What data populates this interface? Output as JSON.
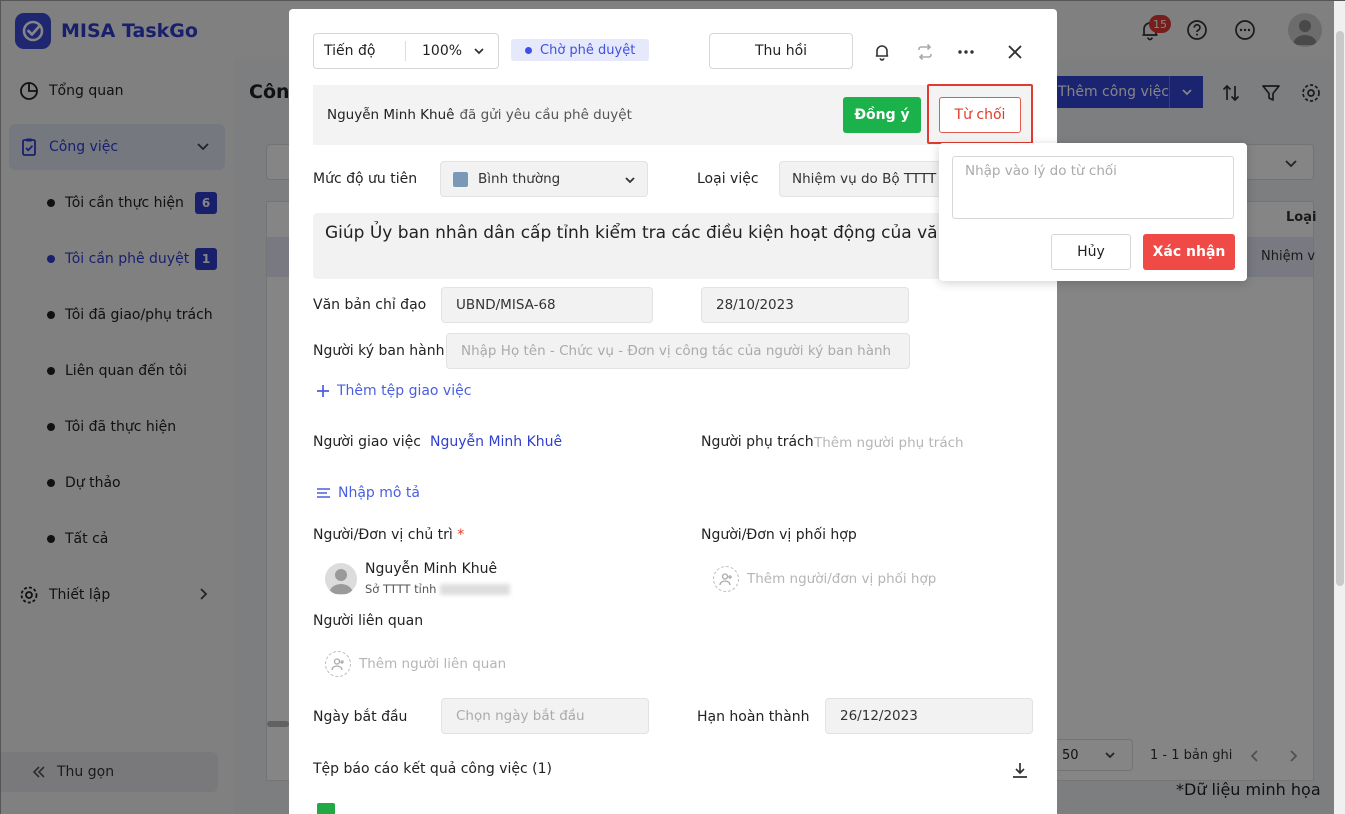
{
  "brand": {
    "name": "MISA TaskGo"
  },
  "sidebar": {
    "items": [
      {
        "label": "Tổng quan"
      },
      {
        "label": "Công việc"
      },
      {
        "label": "Thiết lập"
      }
    ],
    "sub_items": [
      {
        "label": "Tôi cần thực hiện",
        "badge": "6"
      },
      {
        "label": "Tôi cần phê duyệt",
        "badge": "1"
      },
      {
        "label": "Tôi đã giao/phụ trách"
      },
      {
        "label": "Liên quan đến tôi"
      },
      {
        "label": "Tôi đã thực hiện"
      },
      {
        "label": "Dự thảo"
      },
      {
        "label": "Tất cả"
      }
    ],
    "collapse_label": "Thu gọn"
  },
  "header": {
    "notification_count": "15"
  },
  "background": {
    "page_title": "Côn",
    "add_button": "Thêm công việc",
    "column_header": "Loại",
    "column_cell": "Nhiệm v",
    "page_size": "50",
    "pager_info": "1 - 1 bản ghi"
  },
  "modal": {
    "progress_label": "Tiến độ",
    "progress_value": "100%",
    "status": "Chờ phê duyệt",
    "recall_button": "Thu hồi",
    "approval": {
      "requester": "Nguyễn Minh Khuê",
      "message": "đã gửi yêu cầu phê duyệt",
      "agree_button": "Đồng ý",
      "reject_button": "Từ chối"
    },
    "priority_label": "Mức độ ưu tiên",
    "priority_value": "Bình thường",
    "task_type_label": "Loại việc",
    "task_type_value": "Nhiệm vụ do Bộ TTTT gi",
    "title": "Giúp Ủy ban nhân dân cấp tỉnh kiểm tra các điều kiện hoạt động của văn p diện",
    "directive_label": "Văn bản chỉ đạo",
    "directive_value": "UBND/MISA-68",
    "directive_date": "28/10/2023",
    "signer_label": "Người ký ban hành",
    "signer_placeholder": "Nhập Họ tên - Chức vụ - Đơn vị công tác của người ký ban hành",
    "add_attachment": "Thêm tệp giao việc",
    "assigner_label": "Người giao việc",
    "assigner_value": "Nguyễn Minh Khuê",
    "supervisor_label": "Người phụ trách",
    "supervisor_placeholder": "Thêm người phụ trách",
    "description_action": "Nhập mô tả",
    "lead_label": "Người/Đơn vị chủ trì",
    "lead_required": "*",
    "lead_person_name": "Nguyễn Minh Khuê",
    "lead_person_org": "Sở TTTT tỉnh",
    "coop_label": "Người/Đơn vị phối hợp",
    "coop_placeholder": "Thêm người/đơn vị phối hợp",
    "related_label": "Người liên quan",
    "related_placeholder": "Thêm người liên quan",
    "start_label": "Ngày bắt đầu",
    "start_placeholder": "Chọn ngày bắt đầu",
    "deadline_label": "Hạn hoàn thành",
    "deadline_value": "26/12/2023",
    "report_label": "Tệp báo cáo kết quả công việc (1)"
  },
  "reject_popover": {
    "reason_placeholder": "Nhập vào lý do từ chối",
    "cancel_button": "Hủy",
    "confirm_button": "Xác nhận"
  },
  "footnote": "*Dữ liệu minh họa",
  "colors": {
    "brand": "#2f3fd0",
    "approve": "#1bb14b",
    "reject": "#e03b2a",
    "confirm": "#ef4a45"
  }
}
